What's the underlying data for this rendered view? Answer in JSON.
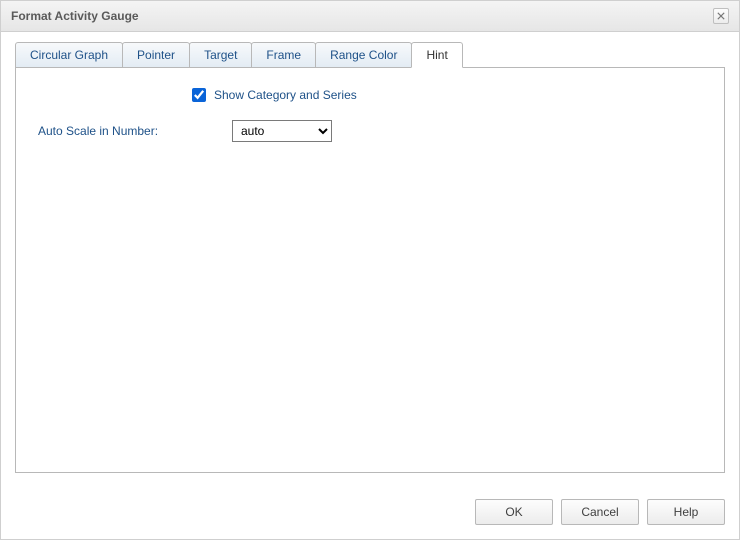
{
  "title": "Format Activity Gauge",
  "tabs": [
    {
      "label": "Circular Graph"
    },
    {
      "label": "Pointer"
    },
    {
      "label": "Target"
    },
    {
      "label": "Frame"
    },
    {
      "label": "Range Color"
    },
    {
      "label": "Hint"
    }
  ],
  "activeTab": "Hint",
  "hintPanel": {
    "showCategoryAndSeries": {
      "label": "Show Category and Series",
      "checked": true
    },
    "autoScale": {
      "label": "Auto Scale in Number:",
      "value": "auto"
    }
  },
  "buttons": {
    "ok": "OK",
    "cancel": "Cancel",
    "help": "Help"
  }
}
